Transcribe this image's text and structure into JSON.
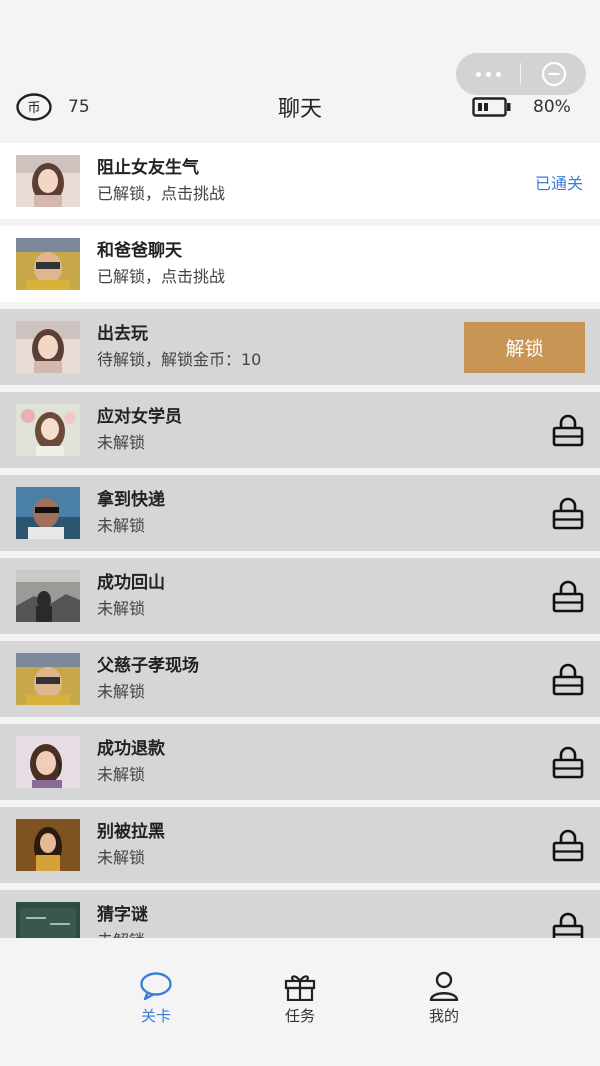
{
  "header": {
    "coin_count": "75",
    "title": "聊天",
    "battery_pct": "80%"
  },
  "levels": [
    {
      "title": "阻止女友生气",
      "subtitle": "已解锁，点击挑战",
      "status": "已通关",
      "state": "done",
      "avatar": "young-woman"
    },
    {
      "title": "和爸爸聊天",
      "subtitle": "已解锁，点击挑战",
      "status": "",
      "state": "done",
      "avatar": "dad"
    },
    {
      "title": "出去玩",
      "subtitle": "待解锁，解锁金币：10",
      "button": "解锁",
      "state": "pending",
      "avatar": "young-woman"
    },
    {
      "title": "应对女学员",
      "subtitle": "未解锁",
      "state": "locked",
      "avatar": "woman-flowers"
    },
    {
      "title": "拿到快递",
      "subtitle": "未解锁",
      "state": "locked",
      "avatar": "man-sunglasses"
    },
    {
      "title": "成功回山",
      "subtitle": "未解锁",
      "state": "locked",
      "avatar": "silhouette"
    },
    {
      "title": "父慈子孝现场",
      "subtitle": "未解锁",
      "state": "locked",
      "avatar": "dad"
    },
    {
      "title": "成功退款",
      "subtitle": "未解锁",
      "state": "locked",
      "avatar": "service-agent"
    },
    {
      "title": "别被拉黑",
      "subtitle": "未解锁",
      "state": "locked",
      "avatar": "woman-gold"
    },
    {
      "title": "猜字谜",
      "subtitle": "未解锁",
      "state": "locked",
      "avatar": "blackboard"
    }
  ],
  "tabs": [
    {
      "label": "关卡",
      "icon": "chat-bubble-icon",
      "active": true
    },
    {
      "label": "任务",
      "icon": "gift-icon",
      "active": false
    },
    {
      "label": "我的",
      "icon": "user-icon",
      "active": false
    }
  ],
  "colors": {
    "accent": "#3b7dd8",
    "unlock_button": "#c99555",
    "locked_row": "#d6d6d6",
    "unlocked_row": "#ffffff"
  }
}
